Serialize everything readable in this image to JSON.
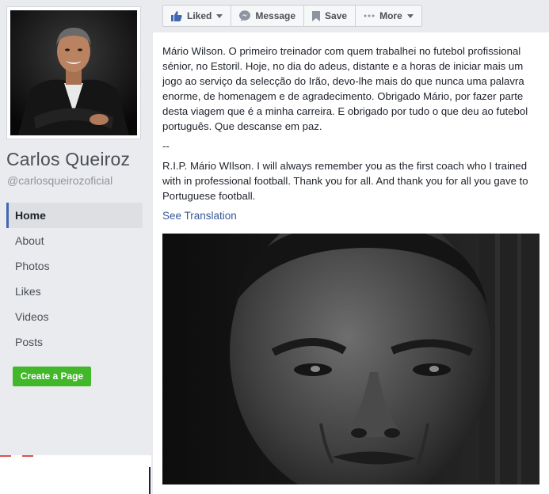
{
  "sidebar": {
    "page_name": "Carlos Queiroz",
    "handle": "@carlosqueirozoficial",
    "nav": [
      {
        "label": "Home",
        "active": true
      },
      {
        "label": "About",
        "active": false
      },
      {
        "label": "Photos",
        "active": false
      },
      {
        "label": "Likes",
        "active": false
      },
      {
        "label": "Videos",
        "active": false
      },
      {
        "label": "Posts",
        "active": false
      }
    ],
    "create_page_label": "Create a Page"
  },
  "toolbar": {
    "liked_label": "Liked",
    "message_label": "Message",
    "save_label": "Save",
    "more_label": "More"
  },
  "post": {
    "text_pt": "Mário Wilson. O primeiro treinador com quem trabalhei no futebol profissional sénior, no Estoril. Hoje, no dia do adeus, distante e a horas de iniciar mais um jogo ao serviço da selecção do Irão, devo-lhe mais do que nunca uma palavra enorme, de homenagem e de agradecimento. Obrigado Mário, por fazer parte desta viagem que é a minha carreira. E obrigado por tudo o que deu ao futebol português. Que descanse em paz.",
    "separator": "--",
    "text_en": "R.I.P. Mário WIlson. I will always remember you as the first coach who I trained with in professional football. Thank you for all. And thank you for all you gave to Portuguese football.",
    "see_translation": "See Translation"
  },
  "colors": {
    "link": "#365899",
    "create_button": "#42b72a",
    "active_nav_border": "#4267b2",
    "background": "#e9ebee"
  },
  "icons": {
    "liked": "thumbs-up-icon",
    "message": "messenger-icon",
    "save": "bookmark-icon",
    "more": "ellipsis-icon"
  }
}
